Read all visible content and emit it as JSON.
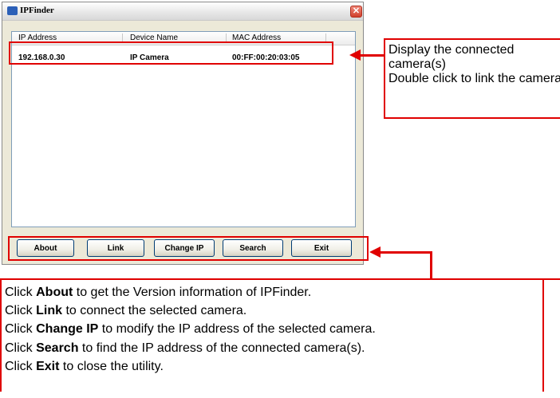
{
  "window": {
    "title": "IPFinder",
    "close_glyph": "✕"
  },
  "list": {
    "columns": [
      "IP Address",
      "Device Name",
      "MAC Address"
    ],
    "rows": [
      {
        "ip": "192.168.0.30",
        "name": "IP Camera",
        "mac": "00:FF:00:20:03:05"
      }
    ]
  },
  "buttons": {
    "about": "About",
    "link": "Link",
    "change_ip": "Change IP",
    "search": "Search",
    "exit": "Exit"
  },
  "callout_right": {
    "line1": "Display the connected camera(s)",
    "line2": "Double click to link the camera"
  },
  "callout_bottom": [
    {
      "pre": "Click ",
      "bold": "About",
      "post": " to get the Version information of IPFinder."
    },
    {
      "pre": "Click ",
      "bold": "Link",
      "post": " to connect the selected camera."
    },
    {
      "pre": "Click ",
      "bold": "Change IP",
      "post": " to modify the IP address of the selected camera."
    },
    {
      "pre": "Click ",
      "bold": "Search",
      "post": " to find the IP address of the connected camera(s)."
    },
    {
      "pre": "Click ",
      "bold": "Exit",
      "post": " to close the utility."
    }
  ],
  "colors": {
    "annotation_red": "#e00000",
    "window_bg": "#ece9d8",
    "button_border": "#003c74"
  }
}
